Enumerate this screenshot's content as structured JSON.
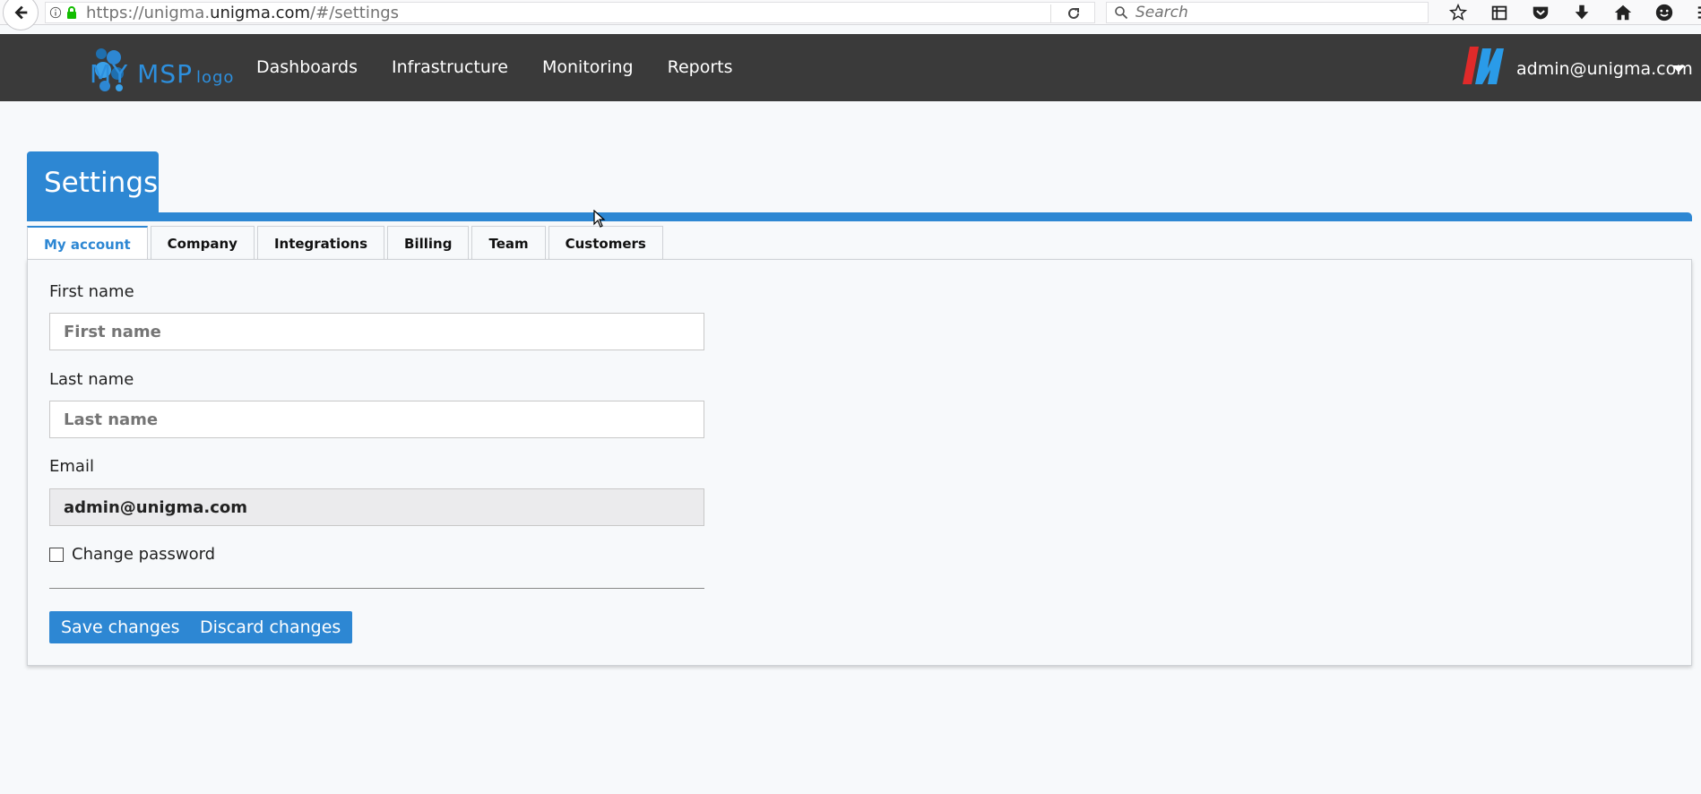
{
  "browser": {
    "url_prefix": "https://unigma.",
    "url_domain": "unigma.com",
    "url_suffix": "/#/settings",
    "search_placeholder": "Search"
  },
  "navbar": {
    "logo_text": "MY MSP",
    "logo_sub": "logo",
    "links": [
      "Dashboards",
      "Infrastructure",
      "Monitoring",
      "Reports"
    ],
    "user_email": "admin@unigma.com"
  },
  "page": {
    "title": "Settings",
    "tabs": [
      "My account",
      "Company",
      "Integrations",
      "Billing",
      "Team",
      "Customers"
    ],
    "active_tab": "My account"
  },
  "form": {
    "first_name_label": "First name",
    "first_name_placeholder": "First name",
    "first_name_value": "",
    "last_name_label": "Last name",
    "last_name_placeholder": "Last name",
    "last_name_value": "",
    "email_label": "Email",
    "email_value": "admin@unigma.com",
    "change_password_label": "Change password",
    "change_password_checked": false,
    "save_label": "Save changes",
    "discard_label": "Discard changes"
  },
  "colors": {
    "accent": "#2d87d3",
    "navbar_bg": "#3a3a3a",
    "page_bg": "#f7f9fb"
  }
}
